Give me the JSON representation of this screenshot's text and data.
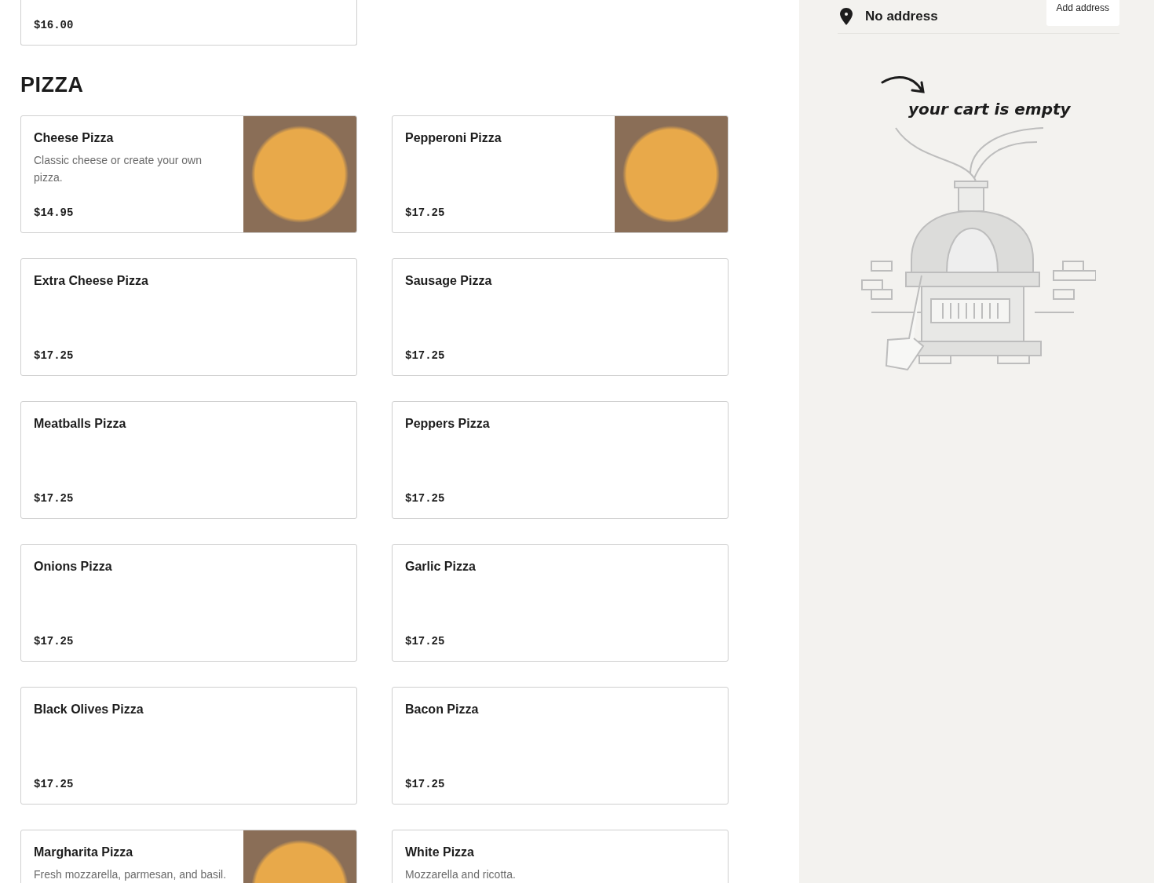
{
  "previous_item": {
    "price": "$16.00"
  },
  "section": {
    "title": "PIZZA",
    "items": [
      {
        "name": "Cheese Pizza",
        "description": "Classic cheese or create your own pizza.",
        "price": "$14.95",
        "photo": true
      },
      {
        "name": "Pepperoni Pizza",
        "price": "$17.25",
        "photo": true
      },
      {
        "name": "Extra Cheese Pizza",
        "price": "$17.25",
        "photo": false
      },
      {
        "name": "Sausage Pizza",
        "price": "$17.25",
        "photo": false
      },
      {
        "name": "Meatballs Pizza",
        "price": "$17.25",
        "photo": false
      },
      {
        "name": "Peppers Pizza",
        "price": "$17.25",
        "photo": false
      },
      {
        "name": "Onions Pizza",
        "price": "$17.25",
        "photo": false
      },
      {
        "name": "Garlic Pizza",
        "price": "$17.25",
        "photo": false
      },
      {
        "name": "Black Olives Pizza",
        "price": "$17.25",
        "photo": false
      },
      {
        "name": "Bacon Pizza",
        "price": "$17.25",
        "photo": false
      },
      {
        "name": "Margharita Pizza",
        "description": "Fresh mozzarella, parmesan, and basil.",
        "photo": true
      },
      {
        "name": "White Pizza",
        "description": "Mozzarella and ricotta.",
        "photo": false
      }
    ]
  },
  "cart": {
    "address": "No address",
    "add_address_button": "Add address",
    "empty_message": "your cart is empty"
  }
}
